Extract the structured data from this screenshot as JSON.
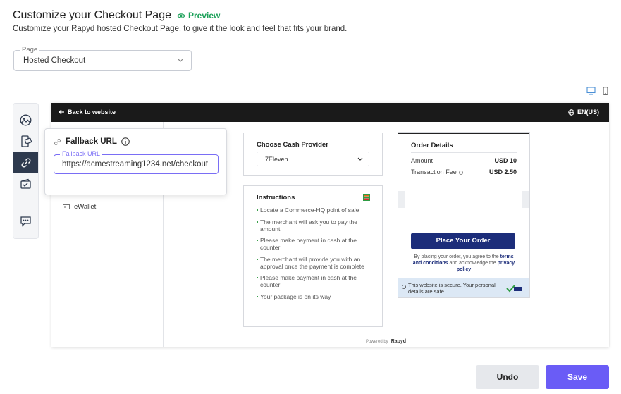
{
  "header": {
    "title": "Customize your Checkout Page",
    "preview_label": "Preview",
    "subtitle": "Customize your Rapyd hosted Checkout Page, to give it the look and feel that fits your brand."
  },
  "page_select": {
    "label": "Page",
    "value": "Hosted Checkout"
  },
  "rail": {
    "items": [
      {
        "icon": "image-icon",
        "active": false
      },
      {
        "icon": "mobile-card-icon",
        "active": false
      },
      {
        "icon": "link-icon",
        "active": true
      },
      {
        "icon": "wallet-check-icon",
        "active": false
      },
      {
        "icon": "chat-icon",
        "active": false
      }
    ]
  },
  "fallback": {
    "title": "Fallback URL",
    "field_label": "Fallback URL",
    "field_value": "https://acmestreaming1234.net/checkout"
  },
  "preview": {
    "back_label": "Back to website",
    "language": "EN(US)",
    "ewallet_label": "eWallet",
    "cash_provider": {
      "title": "Choose Cash Provider",
      "value": "7Eleven"
    },
    "instructions": {
      "title": "Instructions",
      "steps": [
        "Locate a Commerce-HQ point of sale",
        "The merchant will ask you to pay the amount",
        "Please make payment in cash at the counter",
        "The merchant will provide you with an approval once the payment is complete",
        "Please make payment in cash at the counter",
        "Your package is on its way"
      ]
    },
    "order": {
      "title": "Order Details",
      "amount_label": "Amount",
      "amount_value": "USD 10",
      "fee_label": "Transaction Fee",
      "fee_value": "USD 2.50",
      "button_label": "Place Your Order",
      "terms_prefix": "By placing your order, you agree to the",
      "terms_link": "terms and conditions",
      "terms_middle": "and acknowledge the",
      "privacy_link": "privacy policy",
      "secure_text": "This website is secure. Your personal details are safe."
    },
    "powered_prefix": "Powered by",
    "powered_brand": "Rapyd"
  },
  "footer": {
    "undo_label": "Undo",
    "save_label": "Save"
  },
  "colors": {
    "primary": "#6a5cf6",
    "success": "#1ea15a",
    "navy": "#1c2d7a",
    "rail_active": "#2e3a4e"
  }
}
